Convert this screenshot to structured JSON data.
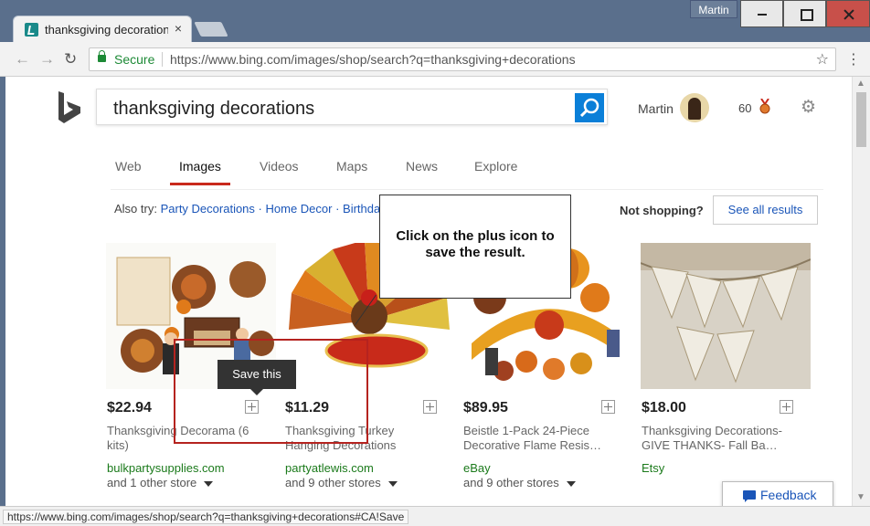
{
  "browser": {
    "tab_title": "thanksgiving decorations",
    "tab_close": "×",
    "user_label": "Martin",
    "secure_label": "Secure",
    "url": "https://www.bing.com/images/shop/search?q=thanksgiving+decorations",
    "status_url": "https://www.bing.com/images/shop/search?q=thanksgiving+decorations#CA!Save"
  },
  "header": {
    "search_query": "thanksgiving decorations",
    "user_name": "Martin",
    "points": "60"
  },
  "tabs": [
    {
      "label": "Web"
    },
    {
      "label": "Images"
    },
    {
      "label": "Videos"
    },
    {
      "label": "Maps"
    },
    {
      "label": "News"
    },
    {
      "label": "Explore"
    }
  ],
  "also_try": {
    "label": "Also try:",
    "links": [
      "Party Decorations",
      "Home Decor",
      "Birthda"
    ]
  },
  "not_shopping": "Not shopping?",
  "see_all": "See all results",
  "products": [
    {
      "price": "$22.94",
      "title": "Thanksgiving Decorama (6 kits)",
      "seller": "bulkpartysupplies.com",
      "stores": "and 1 other store"
    },
    {
      "price": "$11.29",
      "title": "Thanksgiving Turkey Hanging Decorations",
      "seller": "partyatlewis.com",
      "stores": "and 9 other stores"
    },
    {
      "price": "$89.95",
      "title": "Beistle 1-Pack 24-Piece Decorative Flame Resis…",
      "seller": "eBay",
      "stores": "and 9 other stores"
    },
    {
      "price": "$18.00",
      "title": "Thanksgiving Decorations- GIVE THANKS- Fall Ba…",
      "seller": "Etsy",
      "stores": ""
    }
  ],
  "callout": "Click on the plus icon to save the result.",
  "tooltip": "Save this",
  "feedback": "Feedback",
  "colors": {
    "bing_accent": "#0a7fd8",
    "active_tab_underline": "#c9291c",
    "link_blue": "#1a55b8",
    "seller_green": "#1b7a1b",
    "highlight_red": "#b5231f"
  }
}
